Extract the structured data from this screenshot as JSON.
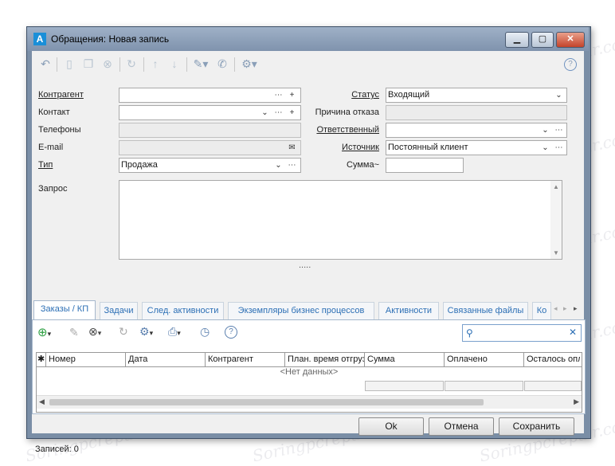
{
  "window": {
    "title": "Обращения: Новая запись",
    "app_icon": "A",
    "controls": [
      "minimize-icon",
      "maximize-icon",
      "close-icon"
    ]
  },
  "toolbar": {
    "help": "?"
  },
  "form": {
    "left": [
      {
        "label": "Контрагент",
        "value": "",
        "link": true
      },
      {
        "label": "Контакт",
        "value": ""
      },
      {
        "label": "Телефоны",
        "value": ""
      },
      {
        "label": "E-mail",
        "value": ""
      },
      {
        "label": "Тип",
        "value": "Продажа",
        "link": true
      }
    ],
    "right": [
      {
        "label": "Статус",
        "value": "Входящий",
        "link": true
      },
      {
        "label": "Причина отказа",
        "value": ""
      },
      {
        "label": "Ответственный",
        "value": "",
        "link": true
      },
      {
        "label": "Источник",
        "value": "Постоянный клиент",
        "link": true
      },
      {
        "label": "Сумма~",
        "value": ""
      }
    ],
    "request_label": "Запрос",
    "splitter": "....."
  },
  "tabs": [
    {
      "label": "Заказы / КП",
      "active": true
    },
    {
      "label": "Задачи"
    },
    {
      "label": "След. активности"
    },
    {
      "label": "Экземпляры бизнес процессов"
    },
    {
      "label": "Активности"
    },
    {
      "label": "Связанные файлы"
    },
    {
      "label": "Ко"
    }
  ],
  "grid": {
    "columns": [
      "Номер",
      "Дата",
      "Контрагент",
      "План. время отгрузки",
      "Сумма",
      "Оплачено",
      "Осталось оплатить"
    ],
    "empty_text": "<Нет данных>"
  },
  "buttons": {
    "ok": "Ok",
    "cancel": "Отмена",
    "save": "Сохранить"
  },
  "status": {
    "records": "Записей: 0"
  },
  "colors": {
    "accent": "#2c6fb5",
    "titlebar": "#8fa2bb"
  }
}
